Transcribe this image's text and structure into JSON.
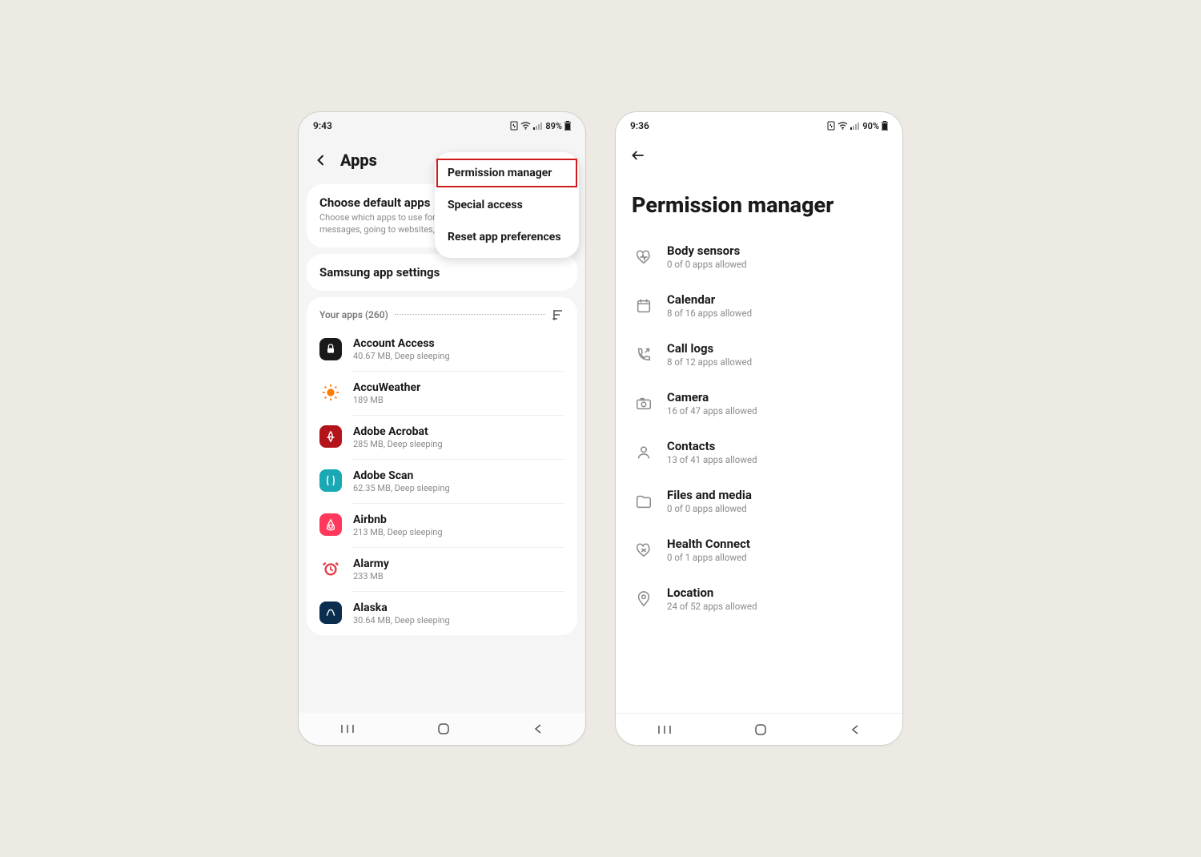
{
  "left": {
    "status": {
      "time": "9:43",
      "battery": "89%"
    },
    "header_title": "Apps",
    "overflow": {
      "items": [
        {
          "label": "Permission manager"
        },
        {
          "label": "Special access"
        },
        {
          "label": "Reset app preferences"
        }
      ]
    },
    "default_apps": {
      "title": "Choose default apps",
      "sub": "Choose which apps to use for making calls, sending messages, going to websites, and more."
    },
    "samsung_card": {
      "title": "Samsung app settings"
    },
    "your_apps_label": "Your apps (260)",
    "apps": [
      {
        "name": "Account Access",
        "sub": "40.67 MB, Deep sleeping",
        "bg": "#1a1a1a",
        "glyph": "lock"
      },
      {
        "name": "AccuWeather",
        "sub": "189 MB",
        "bg": "#ffffff",
        "glyph": "sun"
      },
      {
        "name": "Adobe Acrobat",
        "sub": "285 MB, Deep sleeping",
        "bg": "#b4131a",
        "glyph": "acrobat"
      },
      {
        "name": "Adobe Scan",
        "sub": "62.35 MB, Deep sleeping",
        "bg": "#1aa8b4",
        "glyph": "scan"
      },
      {
        "name": "Airbnb",
        "sub": "213 MB, Deep sleeping",
        "bg": "#ff385c",
        "glyph": "airbnb"
      },
      {
        "name": "Alarmy",
        "sub": "233 MB",
        "bg": "#ffffff",
        "glyph": "alarm"
      },
      {
        "name": "Alaska",
        "sub": "30.64 MB, Deep sleeping",
        "bg": "#0b2e4f",
        "glyph": "alaska"
      }
    ]
  },
  "right": {
    "status": {
      "time": "9:36",
      "battery": "90%"
    },
    "header_title": "Permission manager",
    "permissions": [
      {
        "title": "Body sensors",
        "sub": "0 of 0 apps allowed",
        "icon": "heart"
      },
      {
        "title": "Calendar",
        "sub": "8 of 16 apps allowed",
        "icon": "calendar"
      },
      {
        "title": "Call logs",
        "sub": "8 of 12 apps allowed",
        "icon": "call"
      },
      {
        "title": "Camera",
        "sub": "16 of 47 apps allowed",
        "icon": "camera"
      },
      {
        "title": "Contacts",
        "sub": "13 of 41 apps allowed",
        "icon": "person"
      },
      {
        "title": "Files and media",
        "sub": "0 of 0 apps allowed",
        "icon": "folder"
      },
      {
        "title": "Health Connect",
        "sub": "0 of 1 apps allowed",
        "icon": "health"
      },
      {
        "title": "Location",
        "sub": "24 of 52 apps allowed",
        "icon": "pin"
      }
    ]
  }
}
